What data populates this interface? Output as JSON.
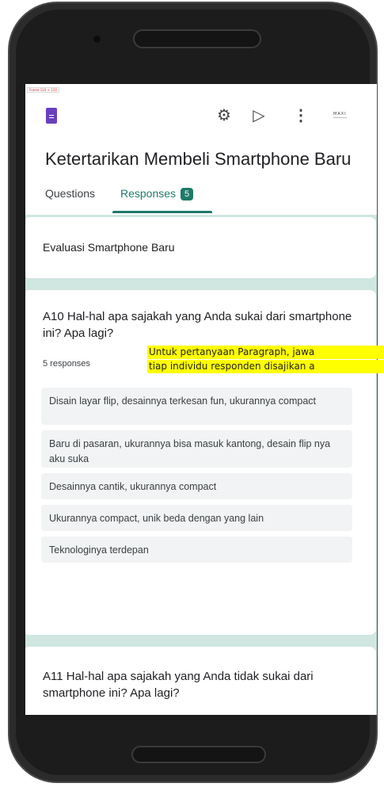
{
  "app": {
    "frame_label": "Frame 110 × 110",
    "form_title": "Ketertarikan Membeli Smartphone Baru",
    "brand_text": "MAXI"
  },
  "toolbar": {
    "icons": [
      "form-icon",
      "palette-icon",
      "send-icon",
      "more-vert-icon"
    ]
  },
  "tabs": [
    {
      "label": "Questions",
      "active": false
    },
    {
      "label": "Responses",
      "active": true,
      "badge": "5"
    }
  ],
  "section": {
    "title": "Evaluasi Smartphone Baru"
  },
  "questions": [
    {
      "label": "A10 Hal-hal apa sajakah yang Anda sukai dari smartphone ini? Apa lagi?",
      "count": "5 responses",
      "responses": [
        "Disain layar flip, desainnya terkesan fun, ukurannya compact",
        "Baru di pasaran, ukurannya bisa masuk kantong, desain flip nya aku suka",
        "Desainnya cantik, ukurannya compact",
        "Ukurannya compact, unik beda dengan yang lain",
        "Teknologinya terdepan"
      ]
    },
    {
      "label": "A11 Hal-hal apa sajakah yang Anda tidak sukai dari smartphone ini? Apa lagi?"
    }
  ],
  "annotation": {
    "line1": "Untuk pertanyaan Paragraph, jawa",
    "line2": "tiap individu responden disajikan a"
  },
  "colors": {
    "accent": "#1e7a6a",
    "form_icon": "#6a3fbf",
    "background": "#cfe6e1",
    "highlight": "#ffff00"
  }
}
